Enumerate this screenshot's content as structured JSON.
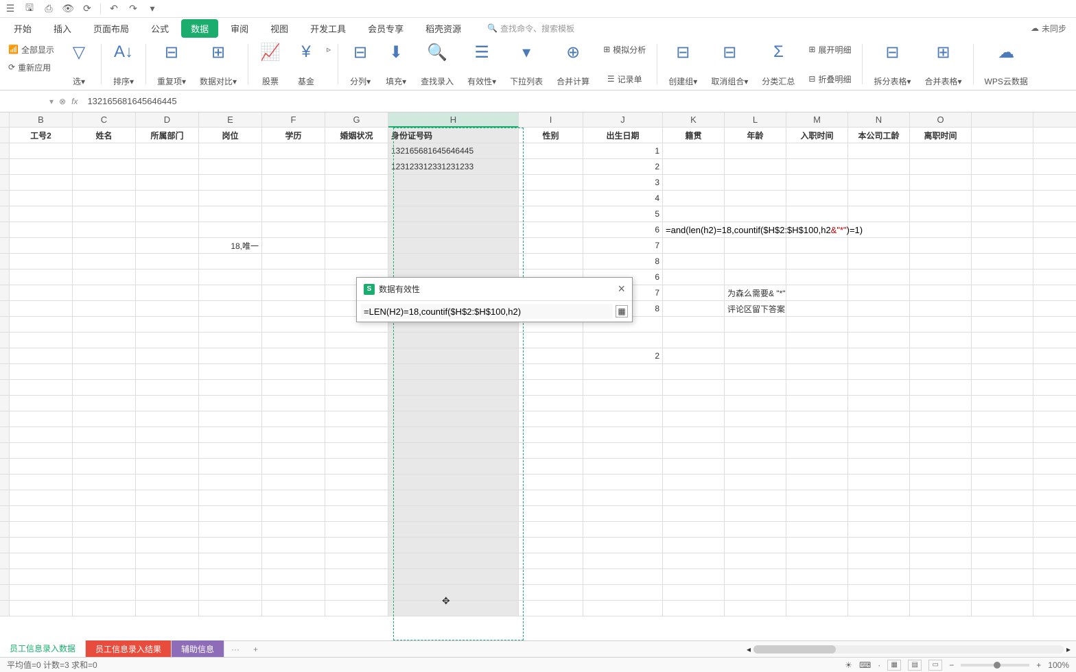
{
  "quick_icons": [
    "⊞",
    "🖫",
    "⎙",
    "⟳",
    "◴",
    "↶",
    "↷",
    "▾"
  ],
  "menus": [
    "开始",
    "插入",
    "页面布局",
    "公式",
    "数据",
    "审阅",
    "视图",
    "开发工具",
    "会员专享",
    "稻壳资源"
  ],
  "active_menu_index": 4,
  "search_cmd": "查找命令、搜索模板",
  "sync_label": "未同步",
  "ribbon": {
    "g1": {
      "a": "全部显示",
      "b": "重新应用",
      "c": "选"
    },
    "g2": "排序",
    "g3": "重复项",
    "g4": "数据对比",
    "g5": "股票",
    "g6": "基金",
    "g7": "分列",
    "g8": "填充",
    "g9": "查找录入",
    "g10": "有效性",
    "g11": "下拉列表",
    "g12": "合并计算",
    "g13a": "模拟分析",
    "g13b": "记录单",
    "g14": "创建组",
    "g15": "取消组合",
    "g16": "分类汇总",
    "g17a": "展开明细",
    "g17b": "折叠明细",
    "g18": "拆分表格",
    "g19": "合并表格",
    "g20": "WPS云数据"
  },
  "formula_bar_value": "132165681645646445",
  "columns": [
    "B",
    "C",
    "D",
    "E",
    "F",
    "G",
    "H",
    "I",
    "J",
    "K",
    "L",
    "M",
    "N",
    "O"
  ],
  "headers": [
    "工号2",
    "姓名",
    "所属部门",
    "岗位",
    "学历",
    "婚姻状况",
    "身份证号码",
    "性别",
    "出生日期",
    "籍贯",
    "年龄",
    "入职时间",
    "本公司工龄",
    "离职时间"
  ],
  "cells": {
    "H2": "132165681645646445",
    "H3": "123123312331231233",
    "J2": "1",
    "J3": "2",
    "J4": "3",
    "J5": "4",
    "J6": "5",
    "J7": "6",
    "J8": "7",
    "J9": "8",
    "J10": "6",
    "J11": "7",
    "J12": "8",
    "J15": "2",
    "E8": "18,唯一",
    "K7": "=and(len(h2)=18,countif($H$2:$H$100,h2",
    "K7_red": "&\"*\"",
    "K7_end": ")=1)",
    "L11": "为森么需要& \"*\"",
    "L12": "评论区留下答案"
  },
  "dialog": {
    "title": "数据有效性",
    "formula": "=LEN(H2)=18,countif($H$2:$H$100,h2)"
  },
  "sheets": {
    "tabs": [
      "员工信息录入数据",
      "员工信息录入结果",
      "辅助信息"
    ],
    "more": "···"
  },
  "status": {
    "left": "平均值=0 计数=3 求和=0",
    "zoom": "100%"
  }
}
